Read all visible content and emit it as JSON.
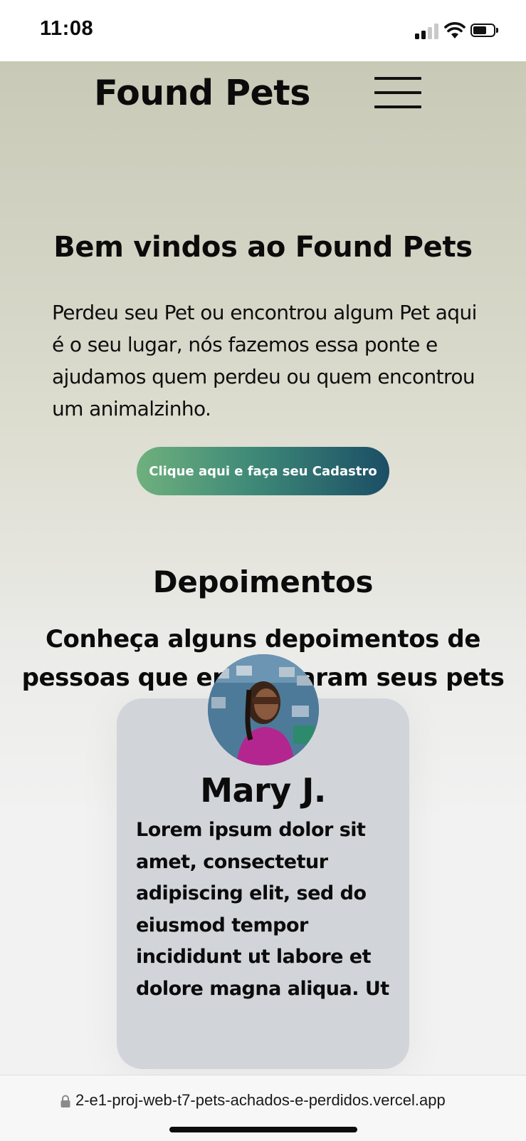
{
  "status_bar": {
    "time": "11:08"
  },
  "header": {
    "brand": "Found Pets",
    "menu_icon": "hamburger-menu-icon"
  },
  "hero": {
    "title": "Bem vindos ao Found Pets",
    "text": "Perdeu seu Pet ou encontrou algum Pet aqui é o seu lugar, nós fazemos essa ponte e ajudamos quem perdeu ou quem encontrou um animalzinho.",
    "cta_label": "Clique aqui e faça seu Cadastro"
  },
  "testimonials": {
    "title": "Depoimentos",
    "subtitle": "Conheça alguns depoimentos de pessoas que encontraram seus pets",
    "items": [
      {
        "name": "Mary J.",
        "text": "Lorem ipsum dolor sit amet, consectetur adipiscing elit, sed do eiusmod tempor incididunt ut labore et dolore magna aliqua. Ut"
      }
    ]
  },
  "browser": {
    "url": "2-e1-proj-web-t7-pets-achados-e-perdidos.vercel.app"
  },
  "colors": {
    "cta_gradient_start": "#6fb07d",
    "cta_gradient_end": "#1b4e66",
    "card_background": "#d1d5da",
    "header_background": "#c8c9b6"
  }
}
